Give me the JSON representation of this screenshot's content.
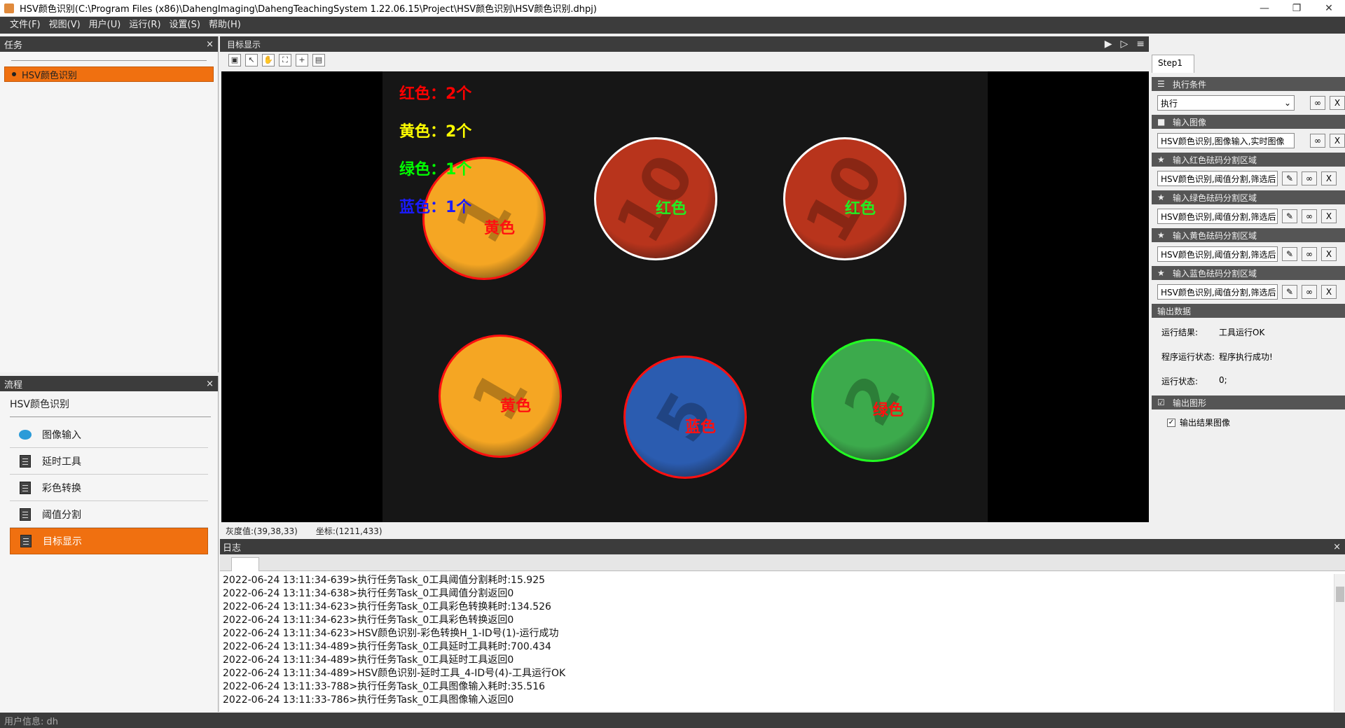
{
  "window": {
    "title": "HSV颜色识别(C:\\Program Files (x86)\\DahengImaging\\DahengTeachingSystem 1.22.06.15\\Project\\HSV颜色识别\\HSV颜色识别.dhpj)",
    "minimize": "—",
    "maximize": "❐",
    "close": "✕"
  },
  "menu": [
    "文件(F)",
    "视图(V)",
    "用户(U)",
    "运行(R)",
    "设置(S)",
    "帮助(H)"
  ],
  "task_panel": {
    "title": "任务",
    "close": "×",
    "item": "HSV颜色识别"
  },
  "flow_panel": {
    "title": "流程",
    "close": "×",
    "project": "HSV颜色识别",
    "steps": [
      {
        "label": "图像输入",
        "icon": "image-input-icon"
      },
      {
        "label": "延时工具",
        "icon": "document-icon"
      },
      {
        "label": "彩色转换",
        "icon": "document-icon"
      },
      {
        "label": "阈值分割",
        "icon": "document-icon"
      },
      {
        "label": "目标显示",
        "icon": "document-icon"
      }
    ]
  },
  "display": {
    "tab_label": "目标显示",
    "run_icon": "▶",
    "step_icon": "▷",
    "menu_icon": "≡",
    "toolbar": [
      "select-box-tool",
      "pointer-tool",
      "pan-hand-tool",
      "fit-view-tool",
      "crosshair-tool",
      "save-tool"
    ],
    "counts": [
      {
        "text": "红色：2个",
        "color": "#ff0000"
      },
      {
        "text": "黄色：2个",
        "color": "#ffff00"
      },
      {
        "text": "绿色：1个",
        "color": "#00ff00"
      },
      {
        "text": "蓝色：1个",
        "color": "#1a1aff"
      }
    ],
    "coins": [
      {
        "label": "黄色",
        "fill": "#f5a623",
        "ring": "#ff1010",
        "num": "1",
        "label_color": "#ff1010"
      },
      {
        "label": "红色",
        "fill": "#b8341c",
        "ring": "#ffffff",
        "num": "10",
        "label_color": "#22ee22"
      },
      {
        "label": "红色",
        "fill": "#b8341c",
        "ring": "#ffffff",
        "num": "10",
        "label_color": "#22ee22"
      },
      {
        "label": "黄色",
        "fill": "#f5a623",
        "ring": "#ff1010",
        "num": "1",
        "label_color": "#ff1010"
      },
      {
        "label": "蓝色",
        "fill": "#2b5cb0",
        "ring": "#ff1010",
        "num": "5",
        "label_color": "#ff1010"
      },
      {
        "label": "绿色",
        "fill": "#3caa4c",
        "ring": "#22ff22",
        "num": "2",
        "label_color": "#ff1010"
      }
    ],
    "gray_value": "灰度值:(39,38,33)",
    "coord": "坐标:(1211,433)"
  },
  "props": {
    "tab": "Step1",
    "exec_condition": {
      "title": "执行条件",
      "value": "执行"
    },
    "input_image": {
      "title": "输入图像",
      "value": "HSV颜色识别,图像输入,实时图像"
    },
    "regions": [
      {
        "title": "输入红色砝码分割区域",
        "value": "HSV颜色识别,阈值分割,筛选后"
      },
      {
        "title": "输入绿色砝码分割区域",
        "value": "HSV颜色识别,阈值分割,筛选后"
      },
      {
        "title": "输入黄色砝码分割区域",
        "value": "HSV颜色识别,阈值分割,筛选后"
      },
      {
        "title": "输入蓝色砝码分割区域",
        "value": "HSV颜色识别,阈值分割,筛选后"
      }
    ],
    "btn_link": "∞",
    "btn_x": "X",
    "btn_pen": "✎",
    "output_data": {
      "title": "输出数据",
      "run_result_k": "运行结果:",
      "run_result_v": "工具运行OK",
      "prog_status_k": "程序运行状态:",
      "prog_status_v": "程序执行成功!",
      "run_state_k": "运行状态:",
      "run_state_v": "0;"
    },
    "output_graphics": {
      "title": "输出图形",
      "checkbox_label": "输出结果图像"
    }
  },
  "log": {
    "title": "日志",
    "close": "×",
    "lines": [
      "2022-06-24 13:11:34-639>执行任务Task_0工具阈值分割耗时:15.925",
      "2022-06-24 13:11:34-638>执行任务Task_0工具阈值分割返回0",
      "2022-06-24 13:11:34-623>执行任务Task_0工具彩色转换耗时:134.526",
      "2022-06-24 13:11:34-623>执行任务Task_0工具彩色转换返回0",
      "2022-06-24 13:11:34-623>HSV颜色识别-彩色转换H_1-ID号(1)-运行成功",
      "2022-06-24 13:11:34-489>执行任务Task_0工具延时工具耗时:700.434",
      "2022-06-24 13:11:34-489>执行任务Task_0工具延时工具返回0",
      "2022-06-24 13:11:34-489>HSV颜色识别-延时工具_4-ID号(4)-工具运行OK",
      "2022-06-24 13:11:33-788>执行任务Task_0工具图像输入耗时:35.516",
      "2022-06-24 13:11:33-786>执行任务Task_0工具图像输入返回0"
    ]
  },
  "status": {
    "user": "用户信息: dh"
  }
}
